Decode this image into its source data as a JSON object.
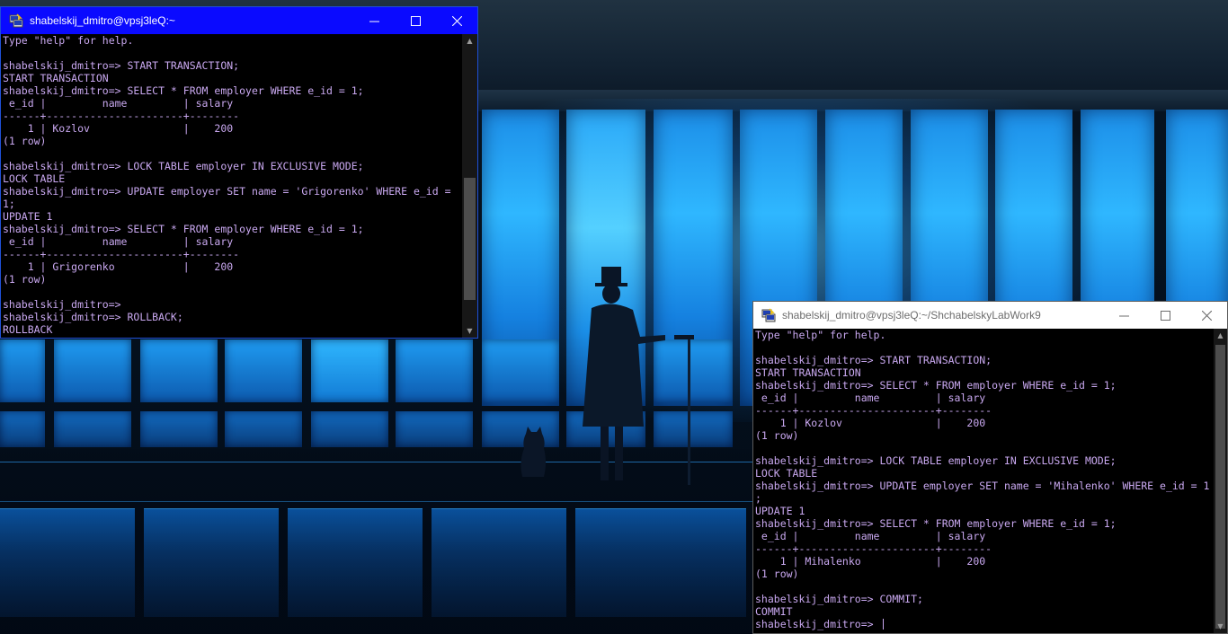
{
  "desktop": {
    "wallpaper": "wallpaper-man-with-top-hat-and-cat-before-glowing-window-wall"
  },
  "terminal_left": {
    "title": "shabelskij_dmitro@vpsj3leQ:~",
    "app_icon": "putty-icon",
    "controls": {
      "minimize": "minimize-icon",
      "maximize": "maximize-icon",
      "close": "close-icon"
    },
    "state": "active",
    "titlebar_color": "#0a0aff",
    "lines": [
      "Type \"help\" for help.",
      "",
      "shabelskij_dmitro=> START TRANSACTION;",
      "START TRANSACTION",
      "shabelskij_dmitro=> SELECT * FROM employer WHERE e_id = 1;",
      " e_id |         name         | salary",
      "------+----------------------+--------",
      "    1 | Kozlov               |    200",
      "(1 row)",
      "",
      "shabelskij_dmitro=> LOCK TABLE employer IN EXCLUSIVE MODE;",
      "LOCK TABLE",
      "shabelskij_dmitro=> UPDATE employer SET name = 'Grigorenko' WHERE e_id =",
      "1;",
      "UPDATE 1",
      "shabelskij_dmitro=> SELECT * FROM employer WHERE e_id = 1;",
      " e_id |         name         | salary",
      "------+----------------------+--------",
      "    1 | Grigorenko           |    200",
      "(1 row)",
      "",
      "shabelskij_dmitro=>",
      "shabelskij_dmitro=> ROLLBACK;",
      "ROLLBACK"
    ]
  },
  "terminal_right": {
    "title": "shabelskij_dmitro@vpsj3leQ:~/ShchabelskyLabWork9",
    "app_icon": "putty-icon",
    "controls": {
      "minimize": "minimize-icon",
      "maximize": "maximize-icon",
      "close": "close-icon"
    },
    "state": "inactive",
    "lines": [
      "Type \"help\" for help.",
      "",
      "shabelskij_dmitro=> START TRANSACTION;",
      "START TRANSACTION",
      "shabelskij_dmitro=> SELECT * FROM employer WHERE e_id = 1;",
      " e_id |         name         | salary",
      "------+----------------------+--------",
      "    1 | Kozlov               |    200",
      "(1 row)",
      "",
      "shabelskij_dmitro=> LOCK TABLE employer IN EXCLUSIVE MODE;",
      "LOCK TABLE",
      "shabelskij_dmitro=> UPDATE employer SET name = 'Mihalenko' WHERE e_id = 1",
      ";",
      "UPDATE 1",
      "shabelskij_dmitro=> SELECT * FROM employer WHERE e_id = 1;",
      " e_id |         name         | salary",
      "------+----------------------+--------",
      "    1 | Mihalenko            |    200",
      "(1 row)",
      "",
      "shabelskij_dmitro=> COMMIT;",
      "COMMIT",
      "shabelskij_dmitro=> "
    ]
  },
  "colors": {
    "terminal_text": "#c9a8f0",
    "terminal_background": "#000000",
    "active_titlebar": "#0a0aff",
    "inactive_titlebar": "#ffffff"
  }
}
